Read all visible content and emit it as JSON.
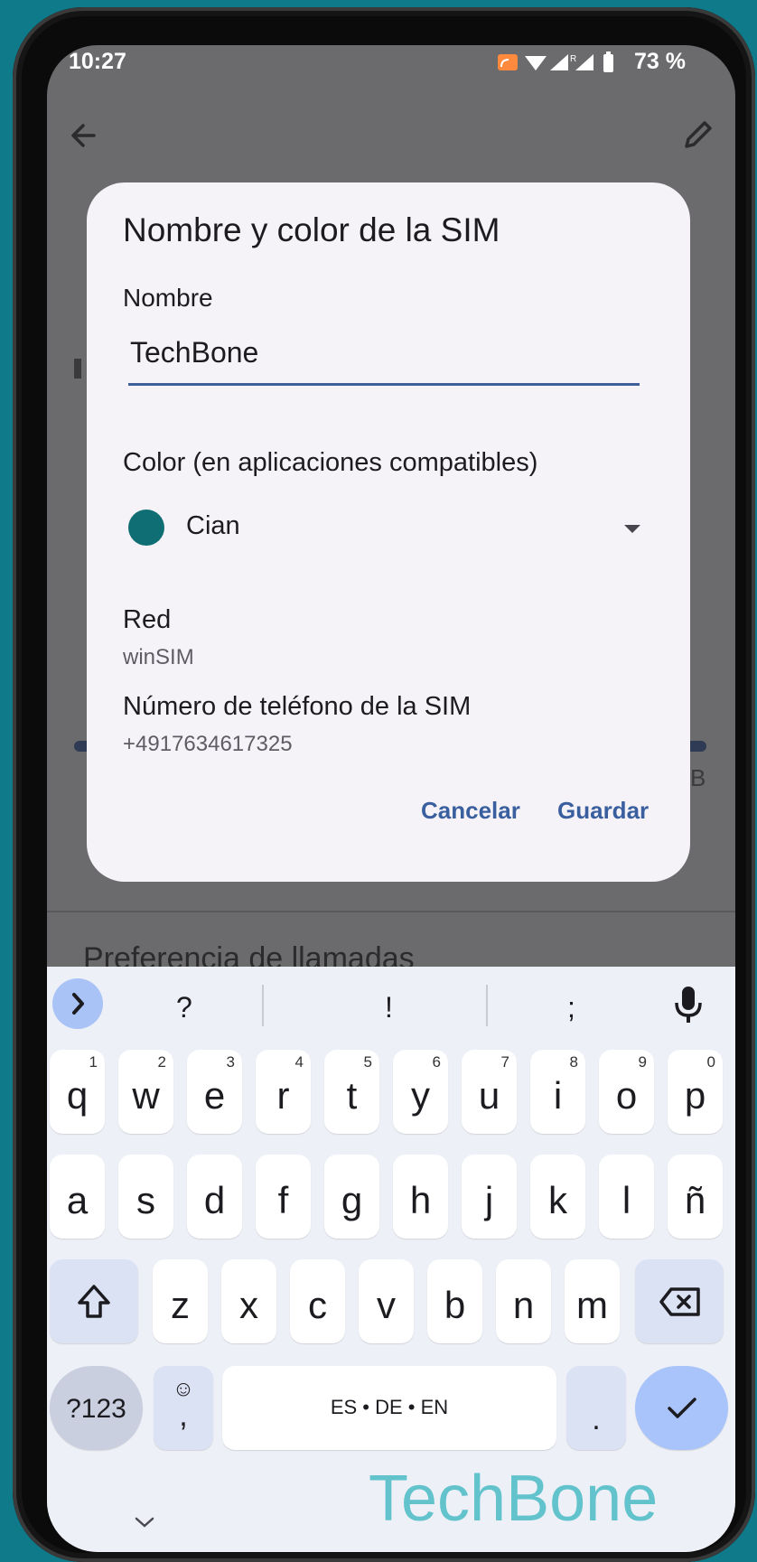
{
  "status_bar": {
    "time": "10:27",
    "battery": "73 %"
  },
  "app_bar": {
    "back_icon": "arrow-left-icon",
    "edit_icon": "pencil-icon"
  },
  "background": {
    "section_title": "Preferencia de llamadas",
    "partial_right": "B"
  },
  "dialog": {
    "title": "Nombre y color de la SIM",
    "name_label": "Nombre",
    "name_value": "TechBone",
    "color_label": "Color (en aplicaciones compatibles)",
    "color_value": "Cian",
    "color_hex": "#0f6e73",
    "network_label": "Red",
    "network_value": "winSIM",
    "phone_label": "Número de teléfono de la SIM",
    "phone_value": "+4917634617325",
    "cancel": "Cancelar",
    "save": "Guardar"
  },
  "keyboard": {
    "suggestions": [
      "?",
      "!",
      ";"
    ],
    "row1": [
      {
        "k": "q",
        "n": "1"
      },
      {
        "k": "w",
        "n": "2"
      },
      {
        "k": "e",
        "n": "3"
      },
      {
        "k": "r",
        "n": "4"
      },
      {
        "k": "t",
        "n": "5"
      },
      {
        "k": "y",
        "n": "6"
      },
      {
        "k": "u",
        "n": "7"
      },
      {
        "k": "i",
        "n": "8"
      },
      {
        "k": "o",
        "n": "9"
      },
      {
        "k": "p",
        "n": "0"
      }
    ],
    "row2": [
      "a",
      "s",
      "d",
      "f",
      "g",
      "h",
      "j",
      "k",
      "l",
      "ñ"
    ],
    "row3": [
      "z",
      "x",
      "c",
      "v",
      "b",
      "n",
      "m"
    ],
    "symbols_key": "?123",
    "emoji_key": "☺",
    "comma_key": ",",
    "space_label": "ES • DE • EN",
    "period_key": "."
  },
  "watermark": "TechBone"
}
